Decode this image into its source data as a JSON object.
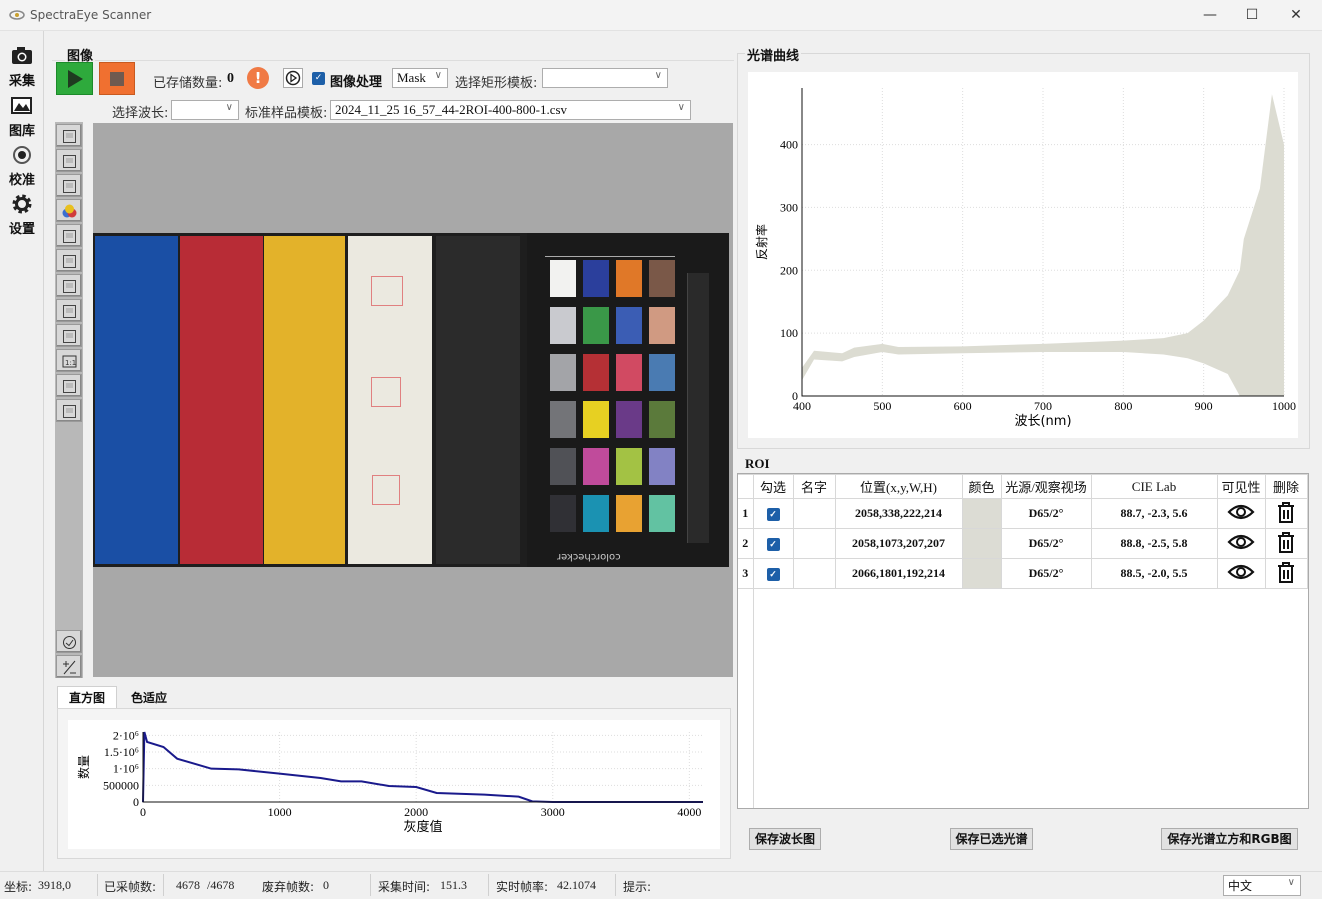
{
  "window": {
    "title": "SpectraEye Scanner",
    "minimize_icon": "minimize-icon",
    "maximize_icon": "maximize-icon",
    "close_icon": "close-icon"
  },
  "nav": [
    {
      "label": "采集",
      "icon": "camera-icon"
    },
    {
      "label": "图库",
      "icon": "gallery-icon"
    },
    {
      "label": "校准",
      "icon": "calibrate-icon"
    },
    {
      "label": "设置",
      "icon": "gear-icon"
    }
  ],
  "image_panel": {
    "title": "图像",
    "stored_label": "已存储数量:",
    "stored_count": "0",
    "image_processing_label": "图像处理",
    "image_processing_checked": true,
    "mask_value": "Mask",
    "rect_template_label": "选择矩形模板:",
    "rect_template_value": "",
    "wavelength_label": "选择波长:",
    "wavelength_value": "",
    "standard_template_label": "标准样品模板:",
    "standard_template_value": "2024_11_25 16_57_44-2ROI-400-800-1.csv",
    "colors": {
      "play": "#2eaa3c",
      "stop": "#f07030",
      "alert": "#f07a45"
    },
    "toolbar_icons": [
      "select-roi-icon",
      "monitor-icon",
      "save-frame-icon",
      "color-wheel-icon",
      "white-balance-icon",
      "palette-icon",
      "save-icon",
      "zoom-in-out-icon",
      "fit-icon",
      "actual-size-icon",
      "rotate-icon",
      "settings-image-icon",
      "check-icon",
      "plus-minus-icon"
    ],
    "strips": [
      "#1a4fa5",
      "#b82c36",
      "#e3b22a",
      "#ebe9e0",
      "#2b2b2b"
    ],
    "checker": [
      [
        "#f2f2f0",
        "#2b3f9c",
        "#e07828",
        "#7a5848"
      ],
      [
        "#c9cacf",
        "#3a9848",
        "#3b5db4",
        "#d09a82"
      ],
      [
        "#a3a4a8",
        "#b53035",
        "#d14a62",
        "#4a7bb2"
      ],
      [
        "#737478",
        "#e7d022",
        "#6a3a88",
        "#5b7a3b"
      ],
      [
        "#505156",
        "#c04b9b",
        "#a3c244",
        "#8282c4"
      ],
      [
        "#303035",
        "#1b92b2",
        "#e8a232",
        "#62c2a2"
      ]
    ],
    "checker_brand": "colorchecker"
  },
  "bottom_tabs": [
    {
      "label": "直方图",
      "active": true
    },
    {
      "label": "色适应",
      "active": false
    }
  ],
  "spectrum_panel": {
    "title": "光谱曲线"
  },
  "chart_data": [
    {
      "type": "line",
      "xlabel": "灰度值",
      "ylabel": "数量",
      "xlim": [
        0,
        4100
      ],
      "ylim": [
        0,
        2100000
      ],
      "xticks": [
        0,
        1000,
        2000,
        3000,
        4000
      ],
      "xtick_labels": [
        "0",
        "1000",
        "2000",
        "3000",
        "4000"
      ],
      "yticks": [
        0,
        500000,
        1000000,
        1500000,
        2000000
      ],
      "ytick_labels": [
        "0",
        "500000",
        "1·10⁶",
        "1.5·10⁶",
        "2·10⁶"
      ],
      "grid": true,
      "color": "#1a1a8c",
      "x": [
        0,
        10,
        30,
        150,
        250,
        500,
        700,
        1000,
        1300,
        1450,
        1600,
        1800,
        2000,
        2150,
        2500,
        2750,
        2850,
        3000,
        4100
      ],
      "y": [
        0,
        2100000,
        1800000,
        1650000,
        1300000,
        1000000,
        980000,
        850000,
        720000,
        620000,
        620000,
        480000,
        450000,
        270000,
        220000,
        160000,
        20000,
        0,
        0
      ]
    },
    {
      "type": "area",
      "xlabel": "波长(nm)",
      "ylabel": "反射率",
      "xlim": [
        400,
        1000
      ],
      "ylim": [
        0,
        490
      ],
      "xticks": [
        400,
        500,
        600,
        700,
        800,
        900,
        1000
      ],
      "xtick_labels": [
        "400",
        "500",
        "600",
        "700",
        "800",
        "900",
        "1000"
      ],
      "yticks": [
        0,
        100,
        200,
        300,
        400
      ],
      "ytick_labels": [
        "0",
        "100",
        "200",
        "300",
        "400"
      ],
      "grid": true,
      "color": "#dcdcd2",
      "x": [
        400,
        415,
        450,
        465,
        500,
        520,
        600,
        700,
        800,
        850,
        880,
        900,
        930,
        945,
        950,
        970,
        985,
        1000
      ],
      "upper": [
        45,
        72,
        68,
        77,
        83,
        78,
        79,
        83,
        88,
        92,
        100,
        120,
        160,
        200,
        250,
        330,
        480,
        400
      ],
      "lower": [
        25,
        58,
        55,
        62,
        70,
        66,
        68,
        70,
        70,
        66,
        60,
        52,
        35,
        0,
        0,
        0,
        0,
        0
      ]
    }
  ],
  "roi": {
    "title": "ROI",
    "headers": [
      "勾选",
      "名字",
      "位置(x,y,W,H)",
      "颜色",
      "光源/观察视场",
      "CIE Lab",
      "可见性",
      "删除"
    ],
    "rows": [
      {
        "index": "1",
        "checked": true,
        "name": "",
        "position": "2058,338,222,214",
        "color": "#dcdcd4",
        "illuminant": "D65/2°",
        "lab": "88.7, -2.3, 5.6"
      },
      {
        "index": "2",
        "checked": true,
        "name": "",
        "position": "2058,1073,207,207",
        "color": "#dcdcd4",
        "illuminant": "D65/2°",
        "lab": "88.8, -2.5, 5.8"
      },
      {
        "index": "3",
        "checked": true,
        "name": "",
        "position": "2066,1801,192,214",
        "color": "#dcdcd4",
        "illuminant": "D65/2°",
        "lab": "88.5, -2.0, 5.5"
      }
    ]
  },
  "buttons": {
    "save_wave": "保存波长图",
    "save_selected": "保存已选光谱",
    "save_cube": "保存光谱立方和RGB图"
  },
  "status": {
    "coord_label": "坐标:",
    "coord": "3918,0",
    "frames_label": "已采帧数:",
    "frames": "4678",
    "frames_total": "/4678",
    "dropped_label": "废弃帧数:",
    "dropped": "0",
    "time_label": "采集时间:",
    "time": "151.3",
    "fps_label": "实时帧率:",
    "fps": "42.1074",
    "hint_label": "提示:",
    "language": "中文"
  }
}
